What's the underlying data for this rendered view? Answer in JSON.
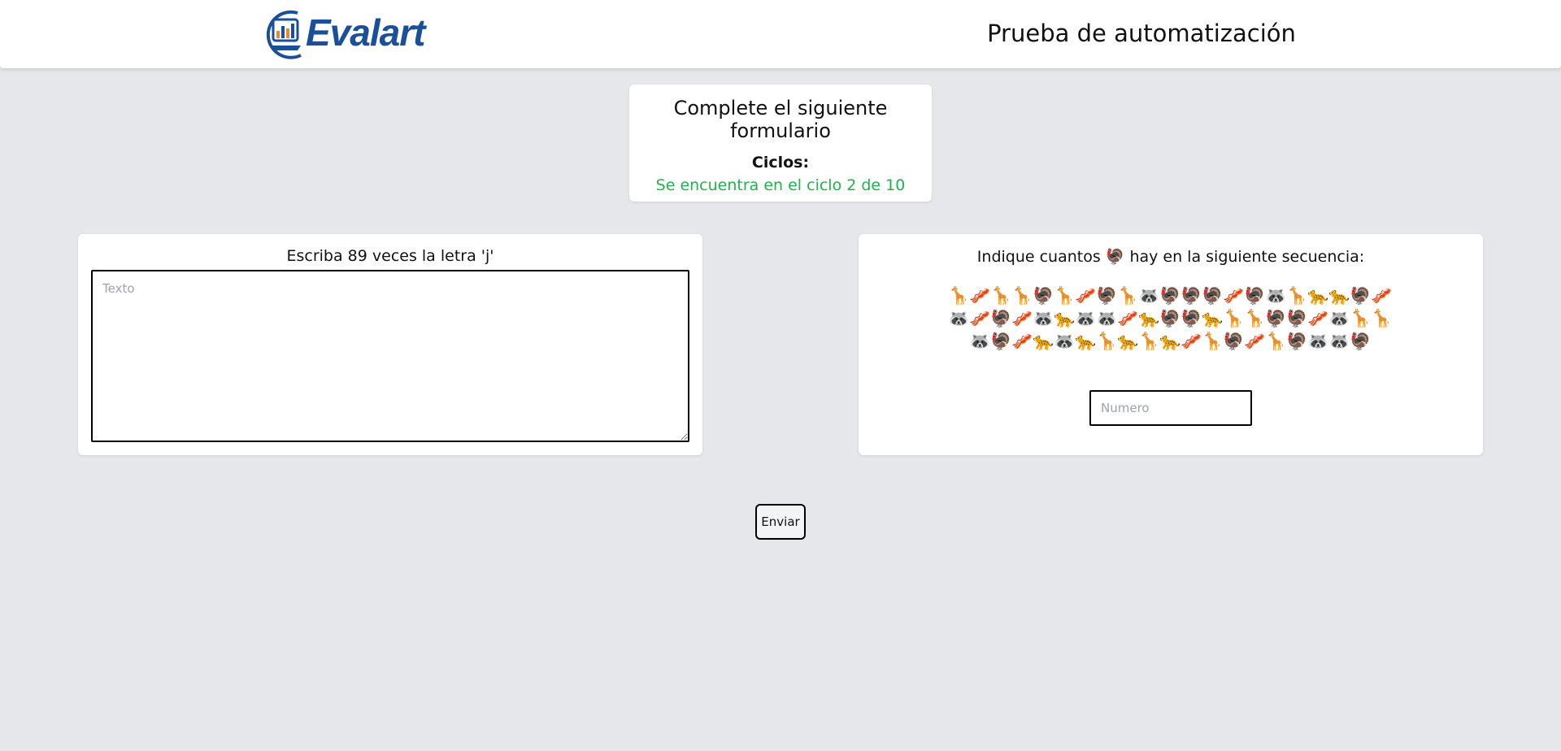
{
  "header": {
    "logo_text": "Evalart",
    "title": "Prueba de automatización"
  },
  "info": {
    "title": "Complete el siguiente formulario",
    "cycles_label": "Ciclos:",
    "cycles_status": "Se encuentra en el ciclo 2 de 10"
  },
  "left": {
    "instruction": "Escriba 89 veces la letra 'j'",
    "textarea_placeholder": "Texto",
    "textarea_value": ""
  },
  "right": {
    "instruction_prefix": "Indique cuantos",
    "target_emoji": "🦃",
    "instruction_suffix": "hay en la siguiente secuencia:",
    "sequence": [
      "🦒",
      "🥓",
      "🦒",
      "🦒",
      "🦃",
      "🦒",
      "🥓",
      "🦃",
      "🦒",
      "🦝",
      "🦃",
      "🦃",
      "🦃",
      "🥓",
      "🦃",
      "🦝",
      "🦒",
      "🐆",
      "🐆",
      "🦃",
      "🥓",
      "🦝",
      "🥓",
      "🦃",
      "🥓",
      "🦝",
      "🐆",
      "🦝",
      "🦝",
      "🥓",
      "🐆",
      "🦃",
      "🦃",
      "🐆",
      "🦒",
      "🦒",
      "🦃",
      "🦃",
      "🥓",
      "🦝",
      "🦒",
      "🦒",
      "🦝",
      "🦃",
      "🥓",
      "🐆",
      "🦝",
      "🐆",
      "🦒",
      "🐆",
      "🦒",
      "🐆",
      "🥓",
      "🦒",
      "🦃",
      "🥓",
      "🦒",
      "🦃",
      "🦝",
      "🦝",
      "🦃"
    ],
    "number_placeholder": "Numero",
    "number_value": ""
  },
  "submit_label": "Enviar",
  "colors": {
    "background": "#e5e7eb",
    "brand_blue": "#1a4f9c",
    "status_green": "#22b14c"
  }
}
